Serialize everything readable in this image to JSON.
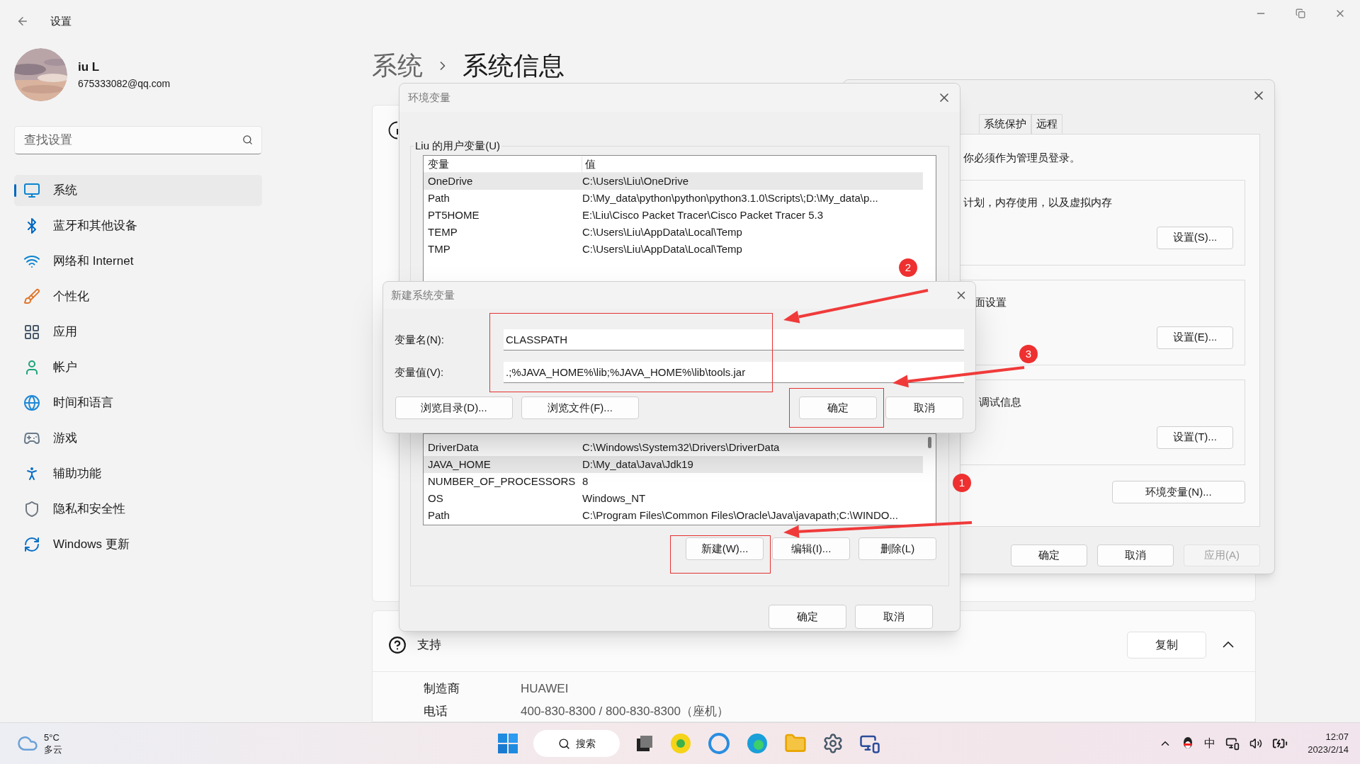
{
  "settings": {
    "title": "设置",
    "user": {
      "name": "iu L",
      "email": "675333082@qq.com"
    },
    "search": {
      "placeholder": "查找设置"
    },
    "nav": [
      {
        "label": "系统",
        "selected": true
      },
      {
        "label": "蓝牙和其他设备",
        "selected": false
      },
      {
        "label": "网络和 Internet",
        "selected": false
      },
      {
        "label": "个性化",
        "selected": false
      },
      {
        "label": "应用",
        "selected": false
      },
      {
        "label": "帐户",
        "selected": false
      },
      {
        "label": "时间和语言",
        "selected": false
      },
      {
        "label": "游戏",
        "selected": false
      },
      {
        "label": "辅助功能",
        "selected": false
      },
      {
        "label": "隐私和安全性",
        "selected": false
      },
      {
        "label": "Windows 更新",
        "selected": false
      }
    ],
    "breadcrumb": [
      "系统",
      "系统信息"
    ],
    "support": {
      "title": "支持",
      "copy_button": "复制",
      "expanded": true,
      "rows": [
        {
          "label": "制造商",
          "value": "HUAWEI"
        },
        {
          "label": "电话",
          "value": "400-830-8300 / 800-830-8300（座机）"
        }
      ]
    }
  },
  "system_properties": {
    "tabs": [
      {
        "label": "系统保护",
        "selected": false
      },
      {
        "label": "远程",
        "selected": false
      }
    ],
    "notice": "你必须作为管理员登录。",
    "sections": [
      {
        "text": "计划，内存使用，以及虚拟内存",
        "button": "设置(S)..."
      },
      {
        "text": "面设置",
        "button": "设置(E)..."
      },
      {
        "text": "调试信息",
        "button": "设置(T)..."
      }
    ],
    "env_button": "环境变量(N)...",
    "buttons": [
      {
        "label": "确定",
        "disabled": false
      },
      {
        "label": "取消",
        "disabled": false
      },
      {
        "label": "应用(A)",
        "disabled": true
      }
    ]
  },
  "env_dialog": {
    "title": "环境变量",
    "user_group": "Liu 的用户变量(U)",
    "columns": [
      "变量",
      "值"
    ],
    "user_rows": [
      {
        "name": "OneDrive",
        "value": "C:\\Users\\Liu\\OneDrive",
        "selected": true
      },
      {
        "name": "Path",
        "value": "D:\\My_data\\python\\python\\python3.1.0\\Scripts\\;D:\\My_data\\p...",
        "selected": false
      },
      {
        "name": "PT5HOME",
        "value": "E:\\Liu\\Cisco Packet Tracer\\Cisco Packet Tracer 5.3",
        "selected": false
      },
      {
        "name": "TEMP",
        "value": "C:\\Users\\Liu\\AppData\\Local\\Temp",
        "selected": false
      },
      {
        "name": "TMP",
        "value": "C:\\Users\\Liu\\AppData\\Local\\Temp",
        "selected": false
      }
    ],
    "system_rows": [
      {
        "name": "DriverData",
        "value": "C:\\Windows\\System32\\Drivers\\DriverData",
        "selected": false
      },
      {
        "name": "JAVA_HOME",
        "value": "D:\\My_data\\Java\\Jdk19",
        "selected": true
      },
      {
        "name": "NUMBER_OF_PROCESSORS",
        "value": "8",
        "selected": false
      },
      {
        "name": "OS",
        "value": "Windows_NT",
        "selected": false
      },
      {
        "name": "Path",
        "value": "C:\\Program Files\\Common Files\\Oracle\\Java\\javapath;C:\\WINDO...",
        "selected": false
      }
    ],
    "system_buttons": [
      "新建(W)...",
      "编辑(I)...",
      "删除(L)"
    ],
    "buttons": [
      "确定",
      "取消"
    ]
  },
  "new_var_dialog": {
    "title": "新建系统变量",
    "fields": [
      {
        "label": "变量名(N):",
        "value": "CLASSPATH"
      },
      {
        "label": "变量值(V):",
        "value": ".;%JAVA_HOME%\\lib;%JAVA_HOME%\\lib\\tools.jar"
      }
    ],
    "browse_buttons": [
      "浏览目录(D)...",
      "浏览文件(F)..."
    ],
    "buttons": [
      "确定",
      "取消"
    ]
  },
  "annotations": [
    "2",
    "3",
    "1"
  ],
  "taskbar": {
    "weather": {
      "temperature": "5°C",
      "condition": "多云"
    },
    "search": "搜索",
    "ime": "中",
    "time": "12:07",
    "date": "2023/2/14"
  }
}
